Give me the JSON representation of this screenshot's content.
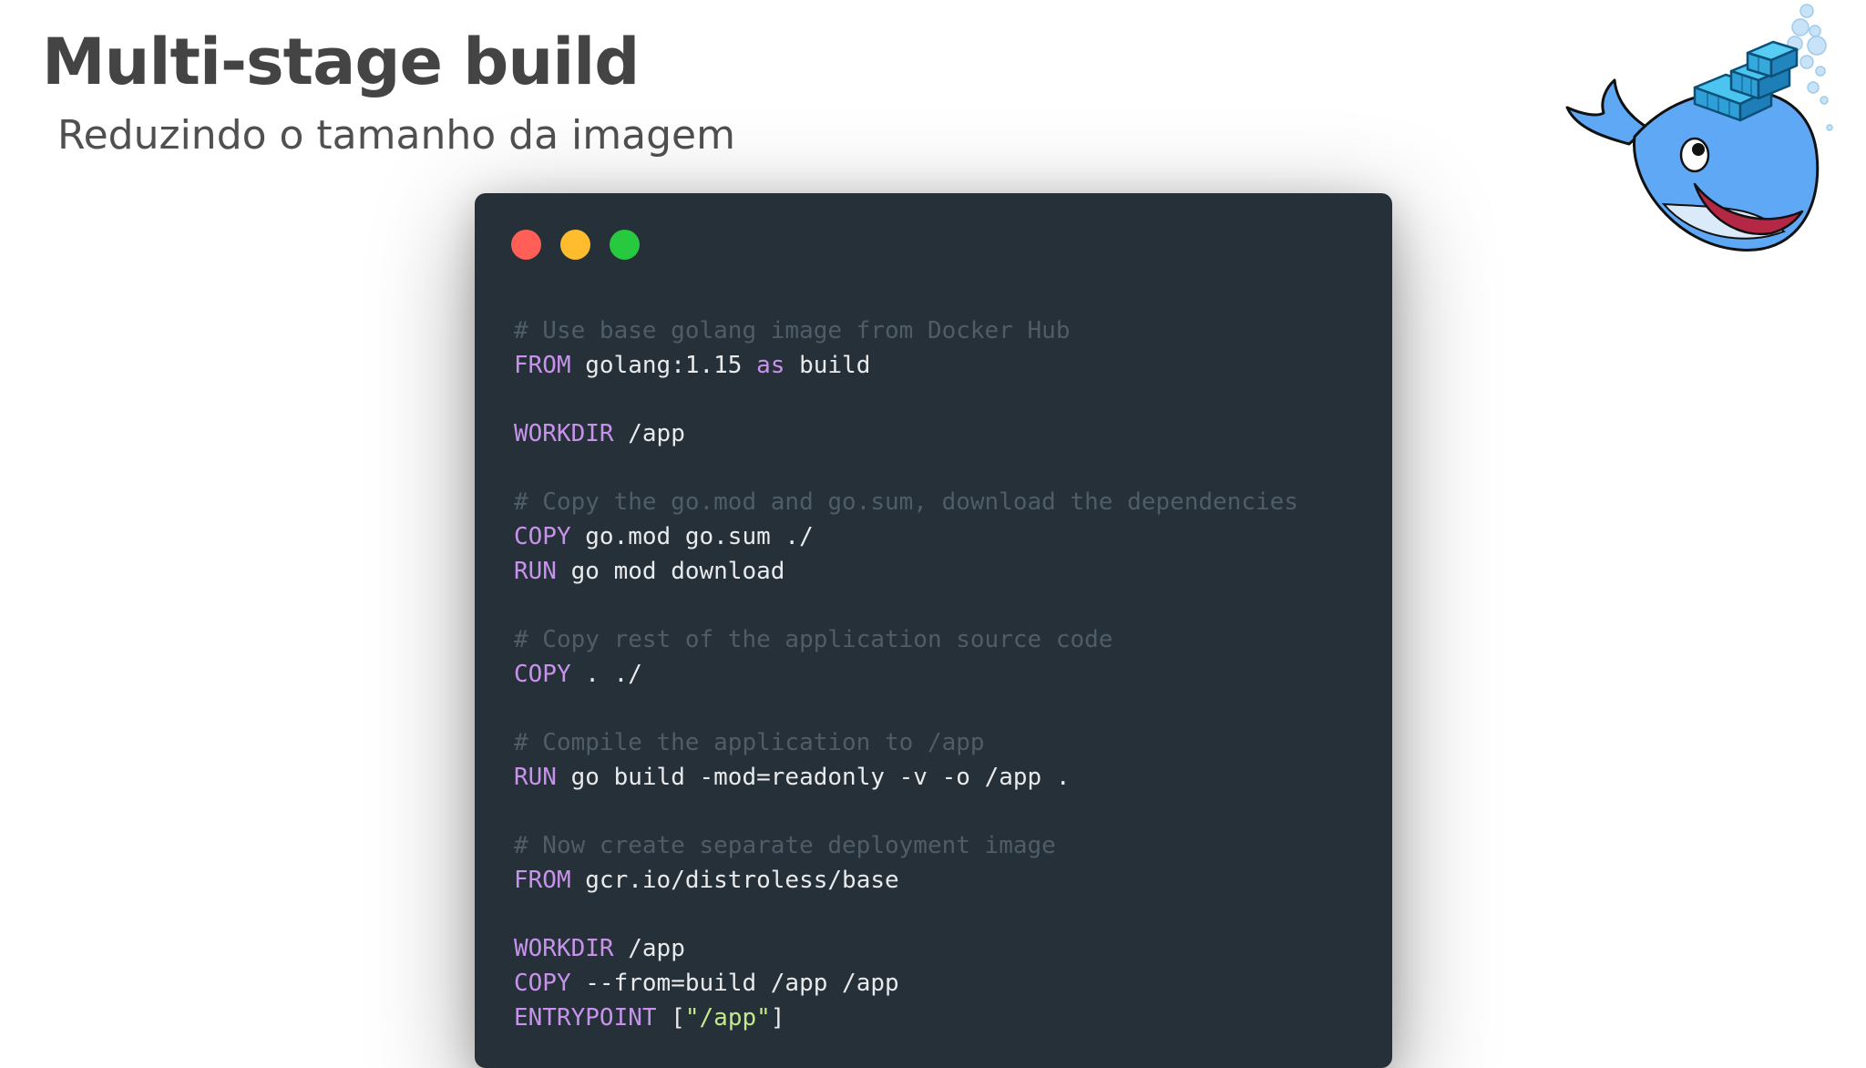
{
  "slide": {
    "title": "Multi-stage build",
    "subtitle": "Reduzindo o tamanho da imagem"
  },
  "colors": {
    "title_text": "#444444",
    "subtitle_text": "#505050",
    "editor_background": "#263038",
    "comment": "#4f5d68",
    "keyword": "#c792ea",
    "plain_text": "#e8eaec",
    "string": "#c3e88d",
    "dot_close": "#ff5f56",
    "dot_minimize": "#ffbd2e",
    "dot_maximize": "#27c93f",
    "whale_body": "#5fa8f5",
    "container_blocks": "#2f9fd8"
  },
  "window_controls": [
    {
      "name": "close-dot",
      "color": "#ff5f56"
    },
    {
      "name": "minimize-dot",
      "color": "#ffbd2e"
    },
    {
      "name": "maximize-dot",
      "color": "#27c93f"
    }
  ],
  "code": {
    "language": "dockerfile",
    "lines": [
      [
        {
          "kind": "comment",
          "text": "# Use base golang image from Docker Hub"
        }
      ],
      [
        {
          "kind": "keyword",
          "text": "FROM"
        },
        {
          "kind": "text",
          "text": " golang:1.15 "
        },
        {
          "kind": "keyword",
          "text": "as"
        },
        {
          "kind": "text",
          "text": " build"
        }
      ],
      [],
      [
        {
          "kind": "keyword",
          "text": "WORKDIR"
        },
        {
          "kind": "text",
          "text": " /app"
        }
      ],
      [],
      [
        {
          "kind": "comment",
          "text": "# Copy the go.mod and go.sum, download the dependencies"
        }
      ],
      [
        {
          "kind": "keyword",
          "text": "COPY"
        },
        {
          "kind": "text",
          "text": " go.mod go.sum ./"
        }
      ],
      [
        {
          "kind": "keyword",
          "text": "RUN"
        },
        {
          "kind": "text",
          "text": " go mod download"
        }
      ],
      [],
      [
        {
          "kind": "comment",
          "text": "# Copy rest of the application source code"
        }
      ],
      [
        {
          "kind": "keyword",
          "text": "COPY"
        },
        {
          "kind": "text",
          "text": " . ./"
        }
      ],
      [],
      [
        {
          "kind": "comment",
          "text": "# Compile the application to /app"
        }
      ],
      [
        {
          "kind": "keyword",
          "text": "RUN"
        },
        {
          "kind": "text",
          "text": " go build -mod=readonly -v -o /app ."
        }
      ],
      [],
      [
        {
          "kind": "comment",
          "text": "# Now create separate deployment image"
        }
      ],
      [
        {
          "kind": "keyword",
          "text": "FROM"
        },
        {
          "kind": "text",
          "text": " gcr.io/distroless/base"
        }
      ],
      [],
      [
        {
          "kind": "keyword",
          "text": "WORKDIR"
        },
        {
          "kind": "text",
          "text": " /app"
        }
      ],
      [
        {
          "kind": "keyword",
          "text": "COPY"
        },
        {
          "kind": "text",
          "text": " --from=build /app /app"
        }
      ],
      [
        {
          "kind": "keyword",
          "text": "ENTRYPOINT"
        },
        {
          "kind": "text",
          "text": " ["
        },
        {
          "kind": "string",
          "text": "\"/app\""
        },
        {
          "kind": "text",
          "text": "]"
        }
      ]
    ]
  },
  "mascot": {
    "icon": "docker-whale-icon"
  }
}
